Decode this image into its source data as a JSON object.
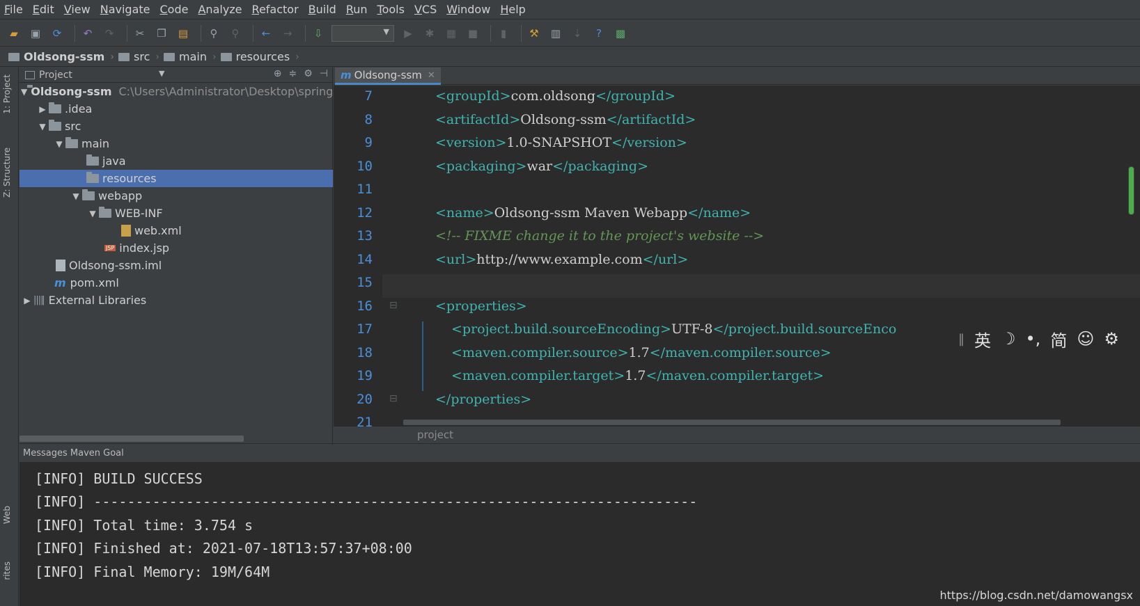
{
  "menu": [
    "File",
    "Edit",
    "View",
    "Navigate",
    "Code",
    "Analyze",
    "Refactor",
    "Build",
    "Run",
    "Tools",
    "VCS",
    "Window",
    "Help"
  ],
  "breadcrumb": [
    "Oldsong-ssm",
    "src",
    "main",
    "resources"
  ],
  "left_strip": {
    "project_tab": "1: Project",
    "structure_tab": "Z: Structure",
    "web_tab": "Web",
    "favorites_tab": "rites"
  },
  "project_panel": {
    "title": "Project",
    "root_label": "Oldsong-ssm",
    "root_path": "C:\\Users\\Administrator\\Desktop\\springr",
    "items": {
      "idea": ".idea",
      "src": "src",
      "main": "main",
      "java": "java",
      "resources": "resources",
      "webapp": "webapp",
      "webinf": "WEB-INF",
      "webxml": "web.xml",
      "indexjsp": "index.jsp",
      "iml": "Oldsong-ssm.iml",
      "pom": "pom.xml",
      "libs": "External Libraries"
    }
  },
  "editor": {
    "tab_label": "Oldsong-ssm",
    "line_numbers": [
      "7",
      "8",
      "9",
      "10",
      "11",
      "12",
      "13",
      "14",
      "15",
      "16",
      "17",
      "18",
      "19",
      "20",
      "21"
    ],
    "lines": {
      "l7": {
        "open": "<groupId>",
        "text": "com.oldsong",
        "close": "</groupId>"
      },
      "l8": {
        "open": "<artifactId>",
        "text": "Oldsong-ssm",
        "close": "</artifactId>"
      },
      "l9": {
        "open": "<version>",
        "text": "1.0-SNAPSHOT",
        "close": "</version>"
      },
      "l10": {
        "open": "<packaging>",
        "text": "war",
        "close": "</packaging>"
      },
      "l12": {
        "open": "<name>",
        "text": "Oldsong-ssm Maven Webapp",
        "close": "</name>"
      },
      "l13": {
        "comment": "<!-- FIXME change it to the project's website -->"
      },
      "l14": {
        "open": "<url>",
        "text": "http://www.example.com",
        "close": "</url>"
      },
      "l16": {
        "open": "<properties>"
      },
      "l17": {
        "open": "<project.build.sourceEncoding>",
        "text": "UTF-8",
        "close": "</project.build.sourceEnco"
      },
      "l18": {
        "open": "<maven.compiler.source>",
        "text": "1.7",
        "close": "</maven.compiler.source>"
      },
      "l19": {
        "open": "<maven.compiler.target>",
        "text": "1.7",
        "close": "</maven.compiler.target>"
      },
      "l20": {
        "close": "</properties>"
      }
    },
    "status_breadcrumb": "project"
  },
  "ime_bar": {
    "sep": "‖",
    "lang": "英",
    "moon": "☽",
    "punct": "•,",
    "simp": "简",
    "emoji": "☺",
    "settings": "⚙"
  },
  "messages": {
    "header": "Messages Maven Goal",
    "log_lines": [
      "[INFO] BUILD SUCCESS",
      "[INFO] ------------------------------------------------------------------------",
      "[INFO] Total time: 3.754 s",
      "[INFO] Finished at: 2021-07-18T13:57:37+08:00",
      "[INFO] Final Memory: 19M/64M"
    ]
  },
  "watermark": "https://blog.csdn.net/damowangsx",
  "colors": {
    "accent": "#4b6eaf",
    "tag": "#40b5b0",
    "comment": "#629755",
    "line_number": "#4a90d9"
  }
}
